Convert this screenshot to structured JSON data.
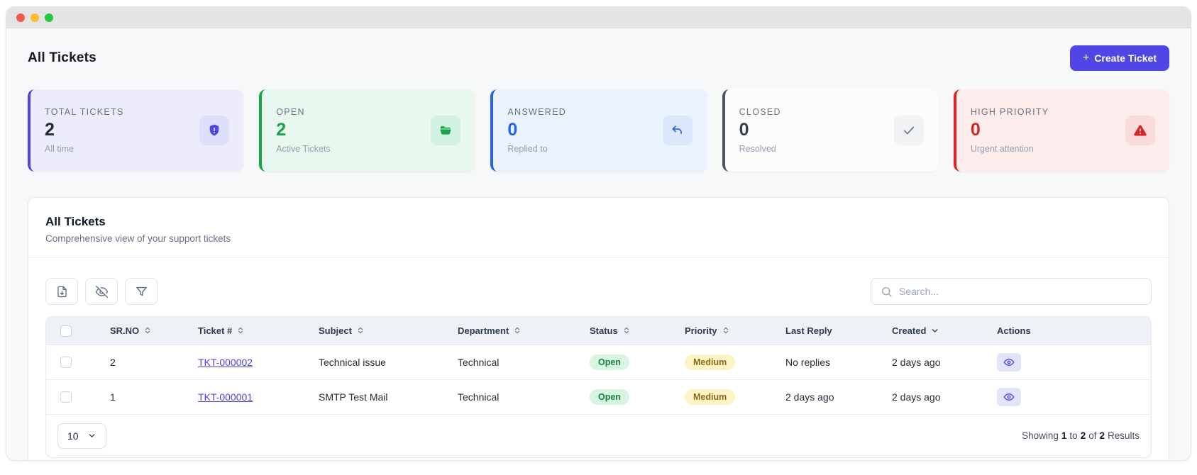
{
  "header": {
    "title": "All Tickets",
    "create_button": {
      "icon": "+",
      "label": "Create Ticket"
    }
  },
  "stats": [
    {
      "label": "TOTAL TICKETS",
      "value": "2",
      "caption": "All time",
      "icon": "shield-alert-icon",
      "accent": "#4f46e5",
      "bg": "#ececfb",
      "value_color": "#212836"
    },
    {
      "label": "OPEN",
      "value": "2",
      "caption": "Active Tickets",
      "icon": "folder-open-icon",
      "accent": "#17a34a",
      "bg": "#e8f8ef",
      "value_color": "#17a34a"
    },
    {
      "label": "ANSWERED",
      "value": "0",
      "caption": "Replied to",
      "icon": "reply-icon",
      "accent": "#2563eb",
      "bg": "#e9f2fd",
      "value_color": "#2563eb"
    },
    {
      "label": "CLOSED",
      "value": "0",
      "caption": "Resolved",
      "icon": "check-icon",
      "accent": "#4b5563",
      "bg": "#fcfcfd",
      "value_color": "#374151"
    },
    {
      "label": "HIGH PRIORITY",
      "value": "0",
      "caption": "Urgent attention",
      "icon": "alert-triangle-icon",
      "accent": "#dc2626",
      "bg": "#fdecec",
      "value_color": "#d92525"
    }
  ],
  "panel": {
    "title": "All Tickets",
    "subtitle": "Comprehensive view of your support tickets",
    "toolbar": {
      "buttons": [
        "file-download",
        "eye-off",
        "filter"
      ]
    },
    "search_placeholder": "Search...",
    "table": {
      "columns": [
        {
          "label": "SR.NO",
          "sort": "both"
        },
        {
          "label": "Ticket #",
          "sort": "both"
        },
        {
          "label": "Subject",
          "sort": "both"
        },
        {
          "label": "Department",
          "sort": "both"
        },
        {
          "label": "Status",
          "sort": "both"
        },
        {
          "label": "Priority",
          "sort": "both"
        },
        {
          "label": "Last Reply",
          "sort": "none"
        },
        {
          "label": "Created",
          "sort": "desc"
        },
        {
          "label": "Actions",
          "sort": "none"
        }
      ],
      "rows": [
        {
          "sr_no": "2",
          "ticket": "TKT-000002",
          "subject": "Technical issue",
          "department": "Technical",
          "status": "Open",
          "priority": "Medium",
          "last_reply": "No replies",
          "created": "2 days ago"
        },
        {
          "sr_no": "1",
          "ticket": "TKT-000001",
          "subject": "SMTP Test Mail",
          "department": "Technical",
          "status": "Open",
          "priority": "Medium",
          "last_reply": "2 days ago",
          "created": "2 days ago"
        }
      ]
    },
    "pagination": {
      "page_size": "10",
      "summary_parts": [
        "Showing",
        "1",
        "to",
        "2",
        "of",
        "2",
        "Results"
      ]
    }
  },
  "colors": {
    "primary": "#4f46e5",
    "status_open": {
      "bg": "#d8f5e2",
      "text": "#178344"
    },
    "priority_medium": {
      "bg": "#fcf3c6",
      "text": "#8a6d1a"
    },
    "table_header_bg": "#eef2f6",
    "content_bg": "#f7f8fa"
  }
}
